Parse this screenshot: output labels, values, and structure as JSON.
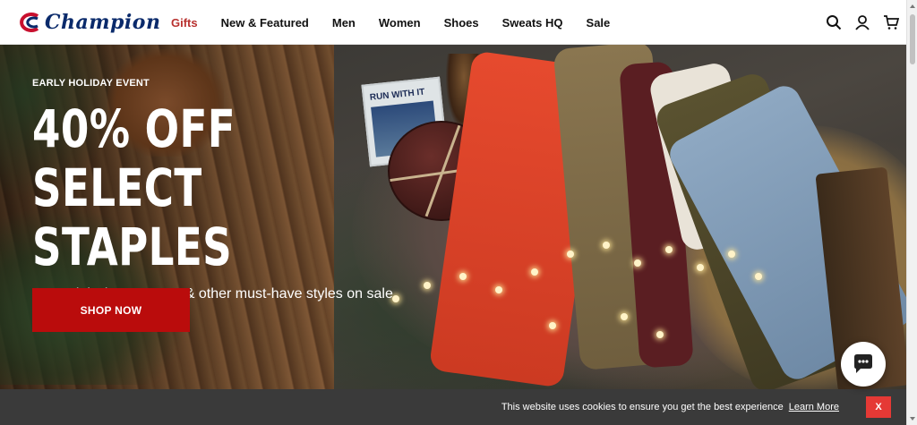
{
  "header": {
    "logo_text": "Champion",
    "nav": [
      {
        "label": "Gifts",
        "accent": true
      },
      {
        "label": "New & Featured"
      },
      {
        "label": "Men"
      },
      {
        "label": "Women"
      },
      {
        "label": "Shoes"
      },
      {
        "label": "Sweats HQ"
      },
      {
        "label": "Sale"
      }
    ],
    "icons": [
      "search-icon",
      "account-icon",
      "cart-icon"
    ]
  },
  "hero": {
    "eyebrow": "EARLY HOLIDAY EVENT",
    "headline_line1": "40% OFF",
    "headline_line2": "SELECT STAPLES",
    "subhead": "Essential winter sweats & other must-have styles on sale",
    "cta_label": "SHOP NOW",
    "magazine_title": "RUN WITH IT"
  },
  "cookie_bar": {
    "text": "This website uses cookies to ensure you get the best experience",
    "link_label": "Learn More",
    "close_label": "X"
  },
  "colors": {
    "accent_nav": "#b8312f",
    "cta_bg": "#ba0c0c",
    "logo_blue": "#0a2a6b",
    "cookie_bg": "#3a3a3a",
    "cookie_close_bg": "#e53935"
  }
}
